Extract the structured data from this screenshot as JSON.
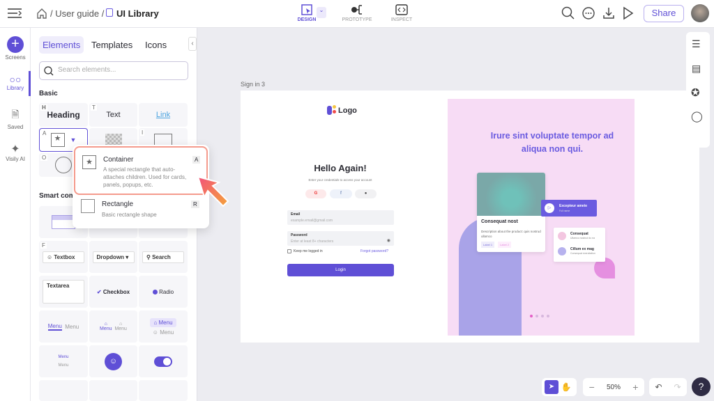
{
  "header": {
    "breadcrumb": [
      "User guide",
      "UI Library"
    ],
    "modes": [
      {
        "label": "DESIGN",
        "active": true
      },
      {
        "label": "PROTOTYPE"
      },
      {
        "label": "INSPECT"
      }
    ],
    "share_label": "Share"
  },
  "rail": {
    "items": [
      "Screens",
      "Library",
      "Saved",
      "Visily AI"
    ]
  },
  "panel": {
    "tabs": [
      "Elements",
      "Templates",
      "Icons"
    ],
    "search_placeholder": "Search elements...",
    "basic_title": "Basic",
    "smart_title": "Smart com",
    "basic": {
      "heading": "Heading",
      "text": "Text",
      "link": "Link",
      "keys": [
        "H",
        "T",
        "A",
        "I",
        "O"
      ]
    },
    "smart": {
      "key": "F",
      "textbox": "Textbox",
      "dropdown": "Dropdown",
      "search": "Search",
      "textarea": "Textarea",
      "checkbox": "Checkbox",
      "radio": "Radio",
      "menu": "Menu"
    }
  },
  "popup": {
    "items": [
      {
        "title": "Container",
        "desc": "A special rectangle that auto-attaches children. Used for cards, panels, popups, etc.",
        "key": "A"
      },
      {
        "title": "Rectangle",
        "desc": "Basic rectangle shape",
        "key": "R"
      }
    ]
  },
  "canvas": {
    "artboard_label": "Sign in 3",
    "signin": {
      "logo": "Logo",
      "title": "Hello Again!",
      "subtitle": "Enter your credentials to access your account",
      "email_label": "Email",
      "email_placeholder": "example.email@gmail.com",
      "password_label": "Password",
      "password_placeholder": "Enter at least 8+ characters",
      "remember": "Keep me logged in",
      "forgot": "Forgot password?",
      "login": "Login"
    },
    "hero": {
      "headline": "Irure sint voluptate tempor ad aliqua non qui.",
      "card_title": "Consequat nost",
      "card_desc": "Description about the product: quis nostrud ullamco",
      "labels": [
        "Label 1",
        "Label 2"
      ],
      "banner_title": "Excepteur amete",
      "banner_sub": "Full name",
      "people": [
        {
          "name": "Consequat",
          "sub": "Ullamco nostrud do ea"
        },
        {
          "name": "Cillum ex mag",
          "sub": "Consequat exercitation"
        }
      ]
    }
  },
  "bottom": {
    "zoom": "50%"
  },
  "colors": {
    "accent": "#5f4fd6",
    "pink_panel": "#f7dcf5",
    "canvas": "#ececf1"
  }
}
